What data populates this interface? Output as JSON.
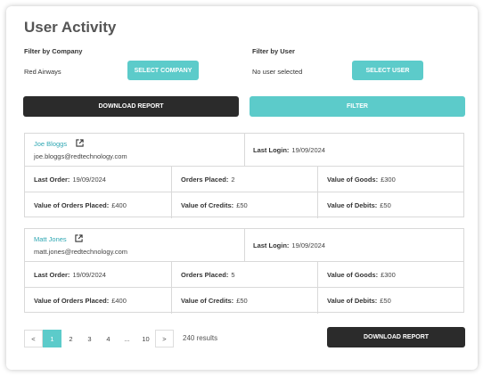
{
  "page": {
    "title": "User Activity"
  },
  "filters": {
    "company_label": "Filter by Company",
    "company_value": "Red Airways",
    "select_company": "SELECT COMPANY",
    "user_label": "Filter by User",
    "user_value": "No user selected",
    "select_user": "SELECT USER"
  },
  "actions": {
    "download": "DOWNLOAD REPORT",
    "filter": "FILTER"
  },
  "labels": {
    "last_login": "Last Login:",
    "last_order": "Last Order:",
    "orders_placed": "Orders Placed:",
    "value_goods": "Value of Goods:",
    "value_orders": "Value of Orders Placed:",
    "value_credits": "Value of Credits:",
    "value_debits": "Value of Debits:"
  },
  "users": [
    {
      "name": "Joe Bloggs",
      "email": "joe.bloggs@redtechnology.com",
      "last_login": "19/09/2024",
      "last_order": "19/09/2024",
      "orders_placed": "2",
      "value_goods": "£300",
      "value_orders": "£400",
      "value_credits": "£50",
      "value_debits": "£50"
    },
    {
      "name": "Matt Jones",
      "email": "matt.jones@redtechnology.com",
      "last_login": "19/09/2024",
      "last_order": "19/09/2024",
      "orders_placed": "5",
      "value_goods": "£300",
      "value_orders": "£400",
      "value_credits": "£50",
      "value_debits": "£50"
    }
  ],
  "pagination": {
    "prev": "<",
    "pages": [
      "1",
      "2",
      "3",
      "4",
      "...",
      "10"
    ],
    "next": ">",
    "results": "240 results"
  },
  "colors": {
    "accent": "#5ccbca",
    "dark": "#2b2b2b",
    "link": "#2fa7b3"
  },
  "icons": {
    "external": "external-link-icon"
  }
}
